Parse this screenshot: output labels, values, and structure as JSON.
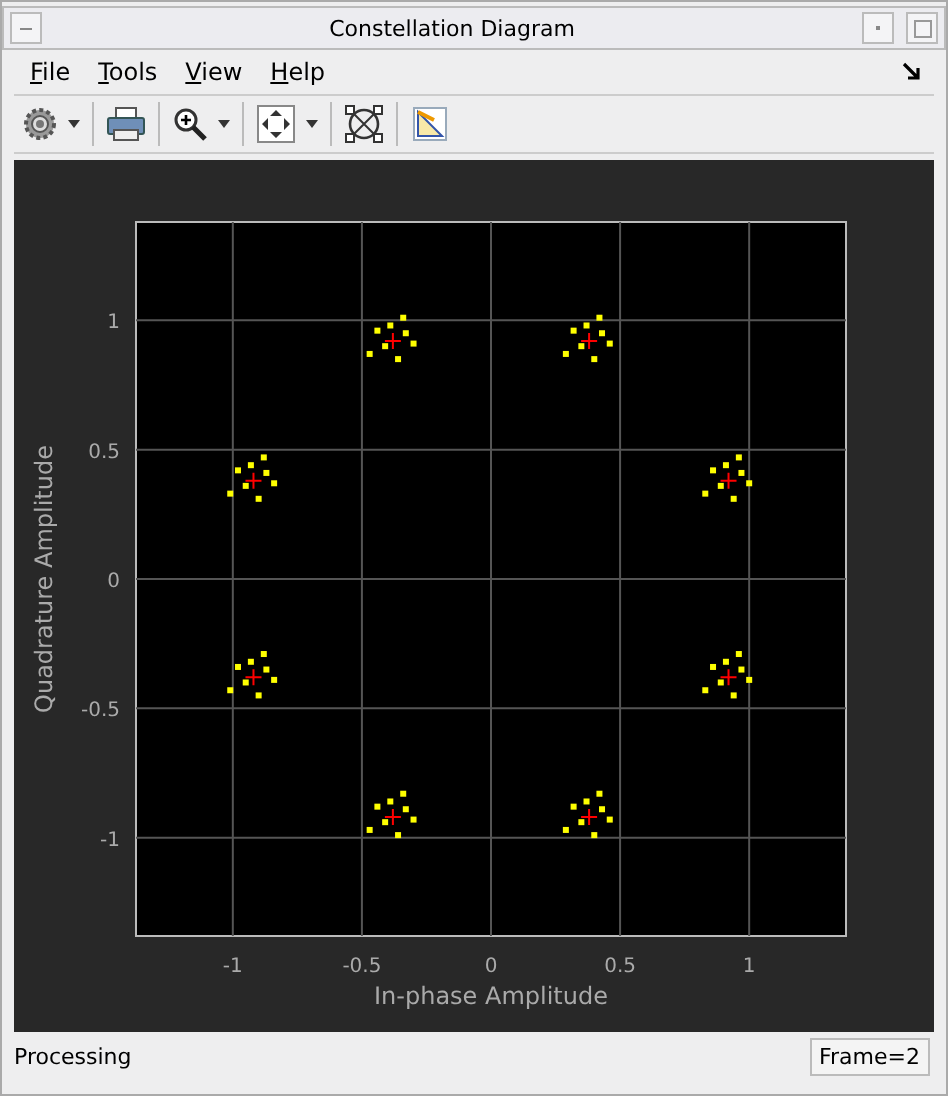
{
  "window": {
    "title": "Constellation Diagram"
  },
  "menu": [
    {
      "label": "File"
    },
    {
      "label": "Tools"
    },
    {
      "label": "View"
    },
    {
      "label": "Help"
    }
  ],
  "plot": {
    "chart_data": {
      "type": "scatter",
      "grid": true,
      "xlabel": "In-phase Amplitude",
      "ylabel": "Quadrature Amplitude",
      "xlim": [
        -1.375,
        1.375
      ],
      "ylim": [
        -1.38,
        1.38
      ],
      "xticks": [
        -1,
        -0.5,
        0,
        0.5,
        1
      ],
      "yticks": [
        -1,
        -0.5,
        0,
        0.5,
        1
      ],
      "x": [
        0.97,
        0.86,
        0.94,
        0.89,
        1.0,
        0.83,
        0.96,
        0.91,
        0.43,
        0.32,
        0.4,
        0.35,
        0.46,
        0.29,
        0.42,
        0.37,
        -0.33,
        -0.44,
        -0.36,
        -0.41,
        -0.3,
        -0.47,
        -0.34,
        -0.39,
        -0.87,
        -0.98,
        -0.9,
        -0.95,
        -0.84,
        -1.01,
        -0.88,
        -0.93,
        -0.87,
        -0.98,
        -0.9,
        -0.95,
        -0.84,
        -1.01,
        -0.88,
        -0.93,
        -0.33,
        -0.44,
        -0.36,
        -0.41,
        -0.3,
        -0.47,
        -0.34,
        -0.39,
        0.43,
        0.32,
        0.4,
        0.35,
        0.46,
        0.29,
        0.42,
        0.37,
        0.97,
        0.86,
        0.94,
        0.89,
        1.0,
        0.83,
        0.96,
        0.91,
        0.92,
        0.38,
        -0.38,
        -0.92,
        -0.92,
        -0.38,
        0.38,
        0.92
      ],
      "series": [
        {
          "color": "#ffff00",
          "values": [
            0.41,
            0.42,
            0.31,
            0.36,
            0.37,
            0.33,
            0.47,
            0.44,
            0.95,
            0.96,
            0.85,
            0.9,
            0.91,
            0.87,
            1.01,
            0.98,
            0.95,
            0.96,
            0.85,
            0.9,
            0.91,
            0.87,
            1.01,
            0.98,
            0.41,
            0.42,
            0.31,
            0.36,
            0.37,
            0.33,
            0.47,
            0.44,
            -0.35,
            -0.34,
            -0.45,
            -0.4,
            -0.39,
            -0.43,
            -0.29,
            -0.32,
            -0.89,
            -0.88,
            -0.99,
            -0.94,
            -0.93,
            -0.97,
            -0.83,
            -0.86,
            -0.89,
            -0.88,
            -0.99,
            -0.94,
            -0.93,
            -0.97,
            -0.83,
            -0.86,
            -0.35,
            -0.34,
            -0.45,
            -0.4,
            -0.39,
            -0.43,
            -0.29,
            -0.32,
            null,
            null,
            null,
            null,
            null,
            null,
            null,
            null
          ]
        },
        {
          "color": "#ff0000",
          "values": [
            null,
            null,
            null,
            null,
            null,
            null,
            null,
            null,
            null,
            null,
            null,
            null,
            null,
            null,
            null,
            null,
            null,
            null,
            null,
            null,
            null,
            null,
            null,
            null,
            null,
            null,
            null,
            null,
            null,
            null,
            null,
            null,
            null,
            null,
            null,
            null,
            null,
            null,
            null,
            null,
            null,
            null,
            null,
            null,
            null,
            null,
            null,
            null,
            null,
            null,
            null,
            null,
            null,
            null,
            null,
            null,
            null,
            null,
            null,
            null,
            null,
            null,
            null,
            null,
            0.38,
            0.92,
            0.92,
            0.38,
            -0.38,
            -0.92,
            -0.92,
            -0.38
          ]
        }
      ]
    }
  },
  "status_bar": {
    "message": "Processing",
    "frame": "Frame=2"
  }
}
